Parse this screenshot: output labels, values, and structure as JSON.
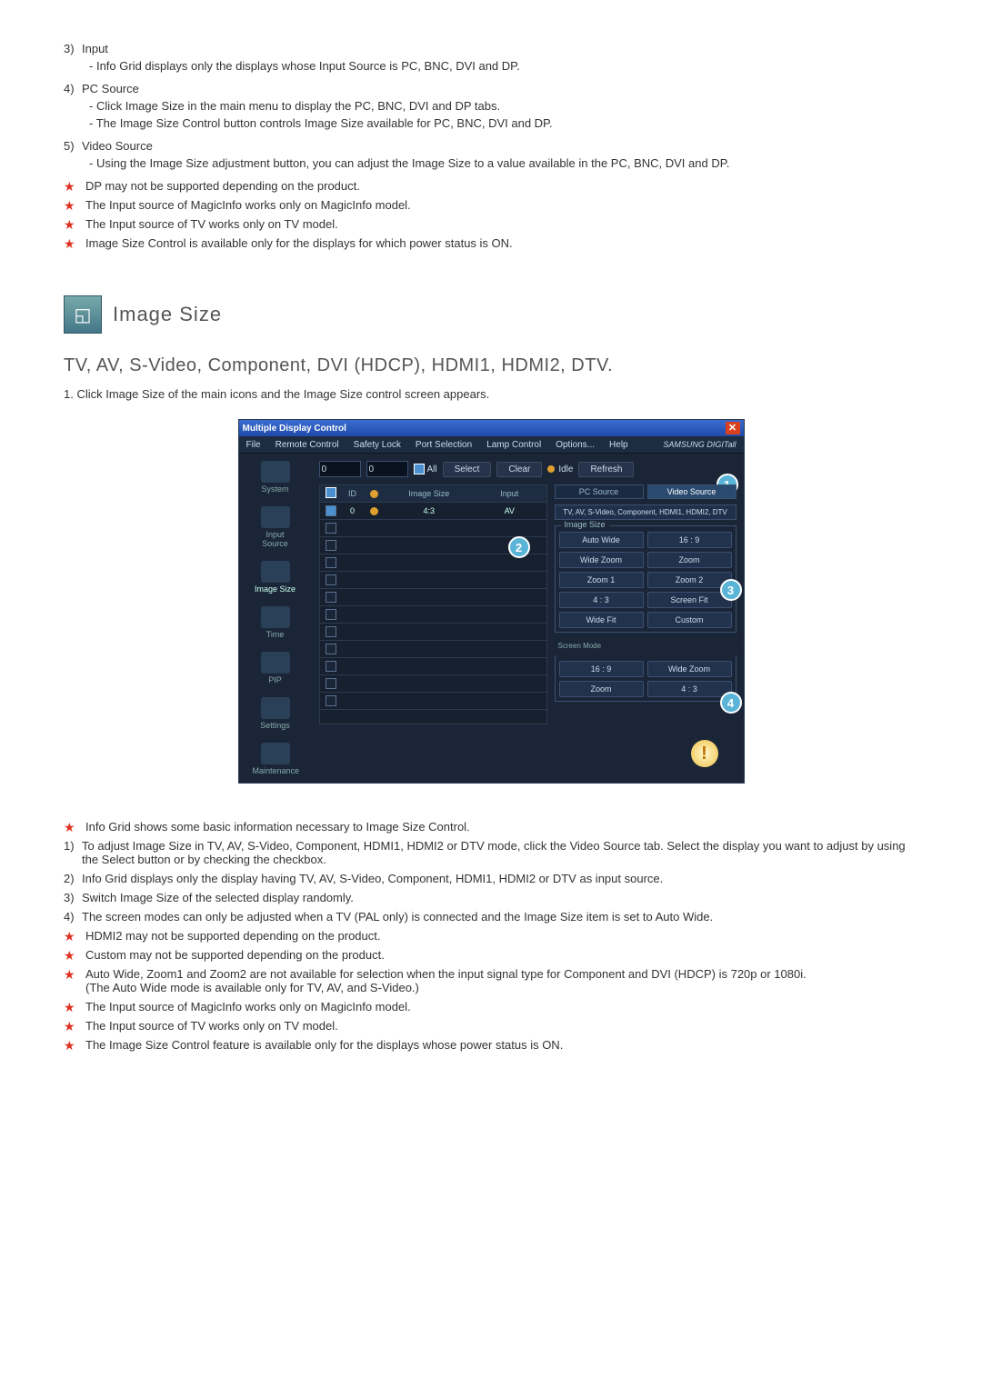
{
  "top_list": [
    {
      "num": "3)",
      "title": "Input",
      "subs": [
        "Info Grid displays only the displays whose Input Source is PC, BNC, DVI and DP."
      ]
    },
    {
      "num": "4)",
      "title": "PC Source",
      "subs": [
        "Click Image Size in the main menu to display the PC, BNC, DVI and DP tabs.",
        "The Image Size Control button controls Image Size available for PC, BNC, DVI and DP."
      ]
    },
    {
      "num": "5)",
      "title": "Video Source",
      "subs": [
        "Using the Image Size adjustment button, you can adjust the Image Size to a value available in the PC, BNC, DVI and DP."
      ]
    }
  ],
  "top_stars": [
    "DP may not be supported depending on the product.",
    "The Input source of MagicInfo works only on MagicInfo model.",
    "The Input source of TV works only on TV model.",
    "Image Size Control is available only for the displays for which power status is ON."
  ],
  "section": {
    "title": "Image Size",
    "subtitle": "TV, AV, S-Video, Component, DVI (HDCP), HDMI1, HDMI2, DTV.",
    "intro_num": "1.",
    "intro": "Click Image Size of the main icons and the Image Size control screen appears."
  },
  "app": {
    "title": "Multiple Display Control",
    "menu": [
      "File",
      "Remote Control",
      "Safety Lock",
      "Port Selection",
      "Lamp Control",
      "Options...",
      "Help"
    ],
    "brand": "SAMSUNG DIGITall",
    "sidebar": [
      {
        "label": "System",
        "active": false
      },
      {
        "label": "Input Source",
        "active": false
      },
      {
        "label": "Image Size",
        "active": true
      },
      {
        "label": "Time",
        "active": false
      },
      {
        "label": "PIP",
        "active": false
      },
      {
        "label": "Settings",
        "active": false
      },
      {
        "label": "Maintenance",
        "active": false
      }
    ],
    "selector1": "0",
    "selector2": "0",
    "check_all": "All",
    "buttons": {
      "select": "Select",
      "clear": "Clear",
      "idle": "Idle",
      "refresh": "Refresh"
    },
    "grid": {
      "headers": {
        "chk": "",
        "id": "ID",
        "status": "",
        "size": "Image Size",
        "input": "Input"
      },
      "row": {
        "id": "0",
        "size": "4:3",
        "input": "AV"
      }
    },
    "tabs": {
      "pc": "PC Source",
      "video": "Video Source"
    },
    "src_label": "TV, AV, S-Video, Component, HDMI1, HDMI2, DTV",
    "image_size_legend": "Image Size",
    "image_size_opts": [
      "Auto Wide",
      "16 : 9",
      "Wide Zoom",
      "Zoom",
      "Zoom 1",
      "Zoom 2",
      "4 : 3",
      "Screen Fit",
      "Wide Fit",
      "Custom"
    ],
    "screen_mode_legend": "Screen Mode",
    "screen_mode_opts": [
      "16 : 9",
      "Wide Zoom",
      "Zoom",
      "4 : 3"
    ],
    "callouts": {
      "c1": "1",
      "c2": "2",
      "c3": "3",
      "c4": "4"
    }
  },
  "bottom_star_head": "Info Grid shows some basic information necessary to Image Size Control.",
  "bottom_list": [
    {
      "num": "1)",
      "text": "To adjust Image Size in TV, AV, S-Video, Component, HDMI1, HDMI2 or DTV mode, click the Video Source tab. Select the display you want to adjust by using the Select button or by checking the checkbox."
    },
    {
      "num": "2)",
      "text": "Info Grid displays only the display having TV, AV, S-Video, Component, HDMI1, HDMI2 or DTV as input source."
    },
    {
      "num": "3)",
      "text": "Switch Image Size of the selected display randomly."
    },
    {
      "num": "4)",
      "text": "The screen modes can only be adjusted when a TV (PAL only) is connected and the Image Size item is set to Auto Wide."
    }
  ],
  "bottom_stars": [
    "HDMI2 may not be supported depending on the product.",
    "Custom may not be supported depending on the product.",
    "Auto Wide, Zoom1 and Zoom2 are not available for selection when the input signal type for Component and DVI (HDCP) is 720p or 1080i.\n(The Auto Wide mode is available only for TV, AV, and S-Video.)",
    "The Input source of MagicInfo works only on MagicInfo model.",
    "The Input source of TV works only on TV model.",
    "The Image Size Control feature is available only for the displays whose power status is ON."
  ]
}
